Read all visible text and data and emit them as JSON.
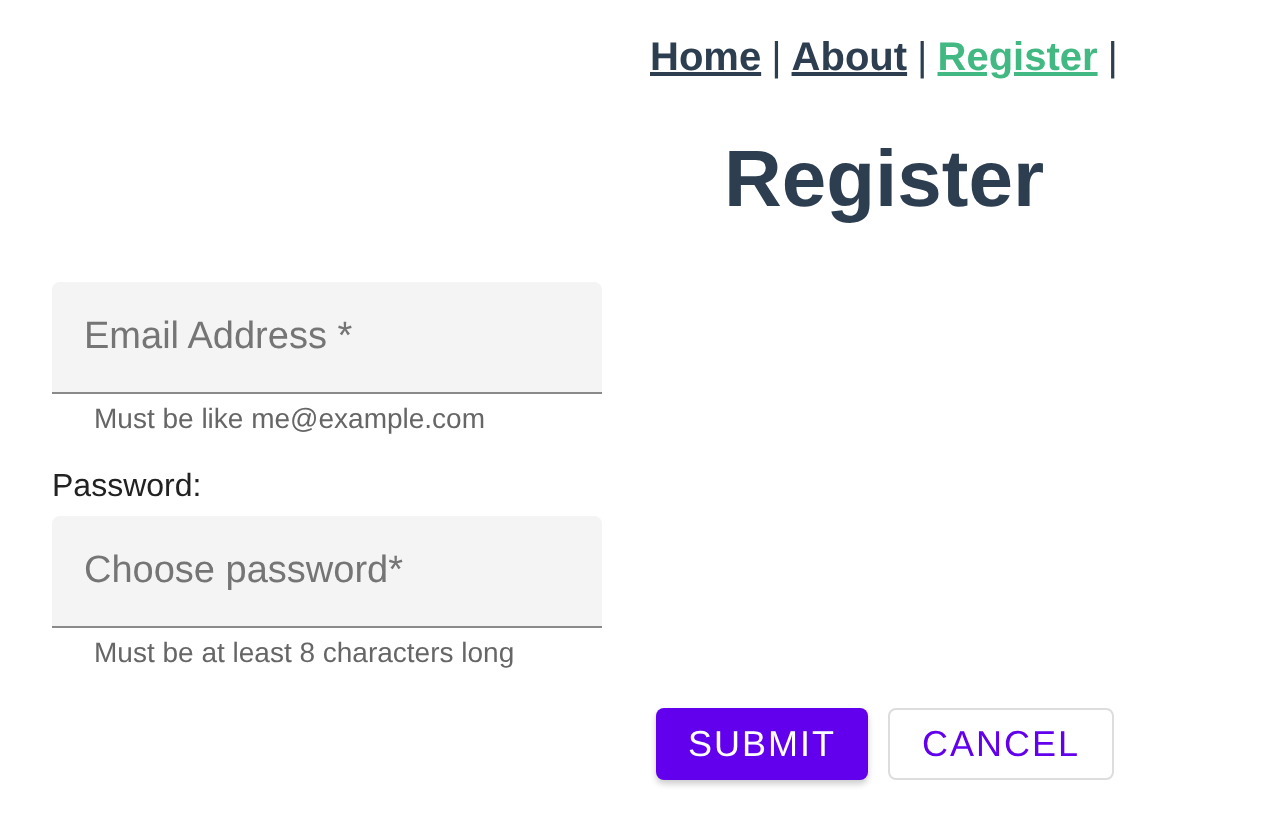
{
  "nav": [
    {
      "label": "Home",
      "selected": false,
      "separator": "|"
    },
    {
      "label": "About",
      "selected": false,
      "separator": "|"
    },
    {
      "label": "Register",
      "selected": true,
      "separator": "|"
    }
  ],
  "heading": "Register",
  "fields": [
    {
      "placeholder": "Email Address *",
      "hint": "Must be like me@example.com"
    },
    {
      "label": "Password:",
      "placeholder": "Choose password*",
      "hint": "Must be at least 8 characters long"
    }
  ],
  "buttons": [
    {
      "label": "SUBMIT",
      "kind": "primary"
    },
    {
      "label": "CANCEL",
      "kind": "outlined"
    }
  ]
}
